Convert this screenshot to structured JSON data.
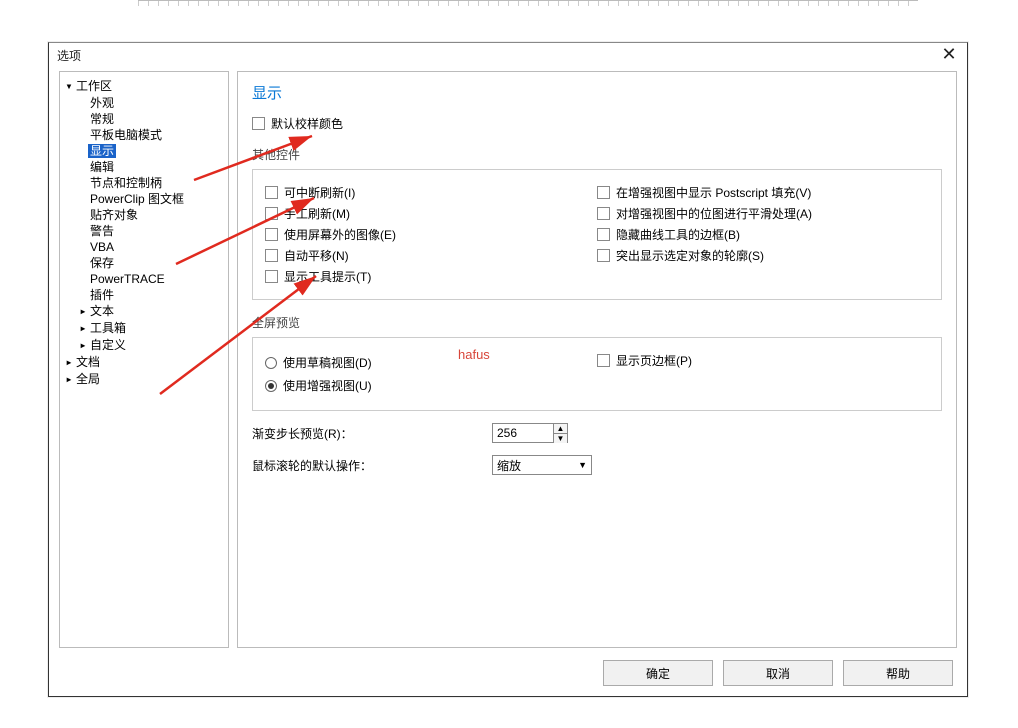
{
  "dialog": {
    "title": "选项"
  },
  "tree": [
    {
      "label": "工作区",
      "depth": 0,
      "expander": "▾"
    },
    {
      "label": "外观",
      "depth": 1
    },
    {
      "label": "常规",
      "depth": 1
    },
    {
      "label": "平板电脑模式",
      "depth": 1
    },
    {
      "label": "显示",
      "depth": 1,
      "selected": true
    },
    {
      "label": "编辑",
      "depth": 1
    },
    {
      "label": "节点和控制柄",
      "depth": 1
    },
    {
      "label": "PowerClip 图文框",
      "depth": 1
    },
    {
      "label": "贴齐对象",
      "depth": 1
    },
    {
      "label": "警告",
      "depth": 1
    },
    {
      "label": "VBA",
      "depth": 1
    },
    {
      "label": "保存",
      "depth": 1
    },
    {
      "label": "PowerTRACE",
      "depth": 1
    },
    {
      "label": "插件",
      "depth": 1
    },
    {
      "label": "文本",
      "depth": 1,
      "expander": "▸"
    },
    {
      "label": "工具箱",
      "depth": 1,
      "expander": "▸"
    },
    {
      "label": "自定义",
      "depth": 1,
      "expander": "▸"
    },
    {
      "label": "文档",
      "depth": 0,
      "expander": "▸"
    },
    {
      "label": "全局",
      "depth": 0,
      "expander": "▸"
    }
  ],
  "panel": {
    "heading": "显示",
    "top_checkbox": "默认校样颜色",
    "group1": {
      "title": "其他控件"
    },
    "checks_left": [
      "可中断刷新(I)",
      "手工刷新(M)",
      "使用屏幕外的图像(E)",
      "自动平移(N)",
      "显示工具提示(T)"
    ],
    "checks_right": [
      "在增强视图中显示 Postscript 填充(V)",
      "对增强视图中的位图进行平滑处理(A)",
      "隐藏曲线工具的边框(B)",
      "突出显示选定对象的轮廓(S)"
    ],
    "group2": {
      "title": "全屏预览",
      "radio_draft": "使用草稿视图(D)",
      "radio_enhanced": "使用增强视图(U)",
      "show_page_border": "显示页边框(P)"
    },
    "row_steps": {
      "label": "渐变步长预览(R)：",
      "value": "256"
    },
    "row_wheel": {
      "label": "鼠标滚轮的默认操作：",
      "value": "缩放"
    }
  },
  "buttons": {
    "ok": "确定",
    "cancel": "取消",
    "help": "帮助"
  },
  "watermark": "hafus"
}
